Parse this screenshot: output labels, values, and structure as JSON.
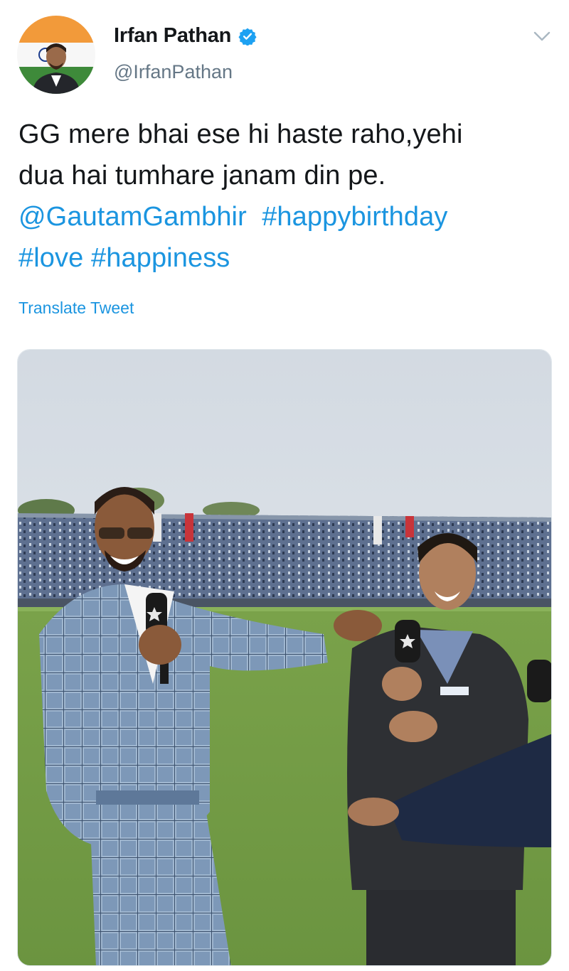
{
  "author": {
    "display_name": "Irfan Pathan",
    "handle": "@IrfanPathan",
    "verified": true,
    "avatar_icon": "profile-photo-with-india-flag"
  },
  "menu": {
    "icon": "chevron-down-icon"
  },
  "tweet": {
    "line1": "GG mere bhai ese hi haste raho,yehi",
    "line2": "dua hai tumhare janam din pe.",
    "mention": "@GautamGambhir",
    "hashtag_birthday": "#happybirthday",
    "hashtag_love": "#love",
    "hashtag_happiness": "#happiness"
  },
  "translate_label": "Translate Tweet",
  "colors": {
    "link": "#1b95e0",
    "text": "#14171a",
    "secondary": "#657786",
    "verified": "#1da1f2"
  }
}
